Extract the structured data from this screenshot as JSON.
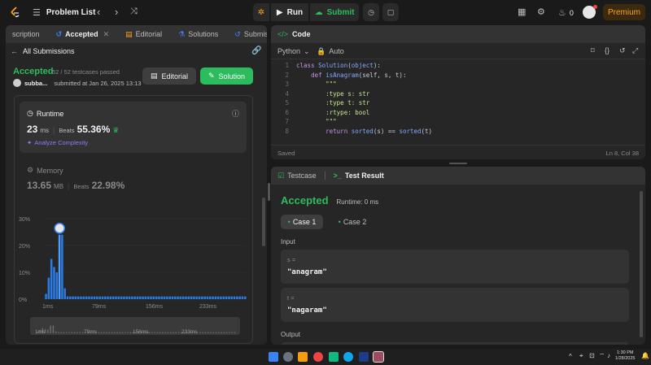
{
  "topbar": {
    "title": "Problem List",
    "run_label": "Run",
    "submit_label": "Submit",
    "streak_count": "0",
    "premium_label": "Premium"
  },
  "left_tabs": {
    "description": "scription",
    "accepted": "Accepted",
    "editorial": "Editorial",
    "solutions": "Solutions",
    "submissions": "Submissions"
  },
  "submission": {
    "back_label": "All Submissions",
    "status": "Accepted",
    "testcases": "52 / 52 testcases passed",
    "user": "subba...",
    "submitted_at": "submitted at Jan 26, 2025 13:13",
    "editorial_btn": "Editorial",
    "solution_btn": "Solution",
    "runtime_label": "Runtime",
    "runtime_value": "23",
    "runtime_unit": "ms",
    "beats_label": "Beats",
    "runtime_beats": "55.36%",
    "analyze_label": "Analyze Complexity",
    "memory_label": "Memory",
    "memory_value": "13.65",
    "memory_unit": "MB",
    "memory_beats": "22.98%"
  },
  "chart_data": {
    "type": "bar",
    "y_ticks": [
      "30%",
      "20%",
      "10%",
      "0%"
    ],
    "x_ticks": [
      "1ms",
      "79ms",
      "156ms",
      "233ms"
    ],
    "ylim": [
      0,
      30
    ],
    "values": [
      2,
      8,
      15,
      12,
      10,
      24,
      24,
      4,
      1,
      1,
      1,
      1,
      1,
      1,
      1,
      1,
      1,
      1,
      1,
      1,
      1,
      1,
      1,
      1,
      1,
      1,
      1,
      1,
      1,
      1,
      1,
      1,
      1,
      1,
      1,
      1,
      1,
      1,
      1,
      1,
      1,
      1,
      1,
      1,
      1,
      1,
      1,
      1,
      1,
      1,
      1,
      1,
      1,
      1,
      1,
      1,
      1,
      1,
      1,
      1,
      1,
      1,
      1,
      1,
      1,
      1,
      1,
      1,
      1,
      1,
      1,
      1,
      1,
      1,
      1
    ],
    "highlight_index": 5,
    "colors": {
      "bar": "#2a7be4",
      "highlight": "#4a9cff"
    }
  },
  "code_panel": {
    "title": "Code",
    "language": "Python",
    "auto_label": "Auto",
    "saved_label": "Saved",
    "cursor_label": "Ln 8, Col 38",
    "lines": [
      {
        "n": "1",
        "t": "class Solution(object):"
      },
      {
        "n": "2",
        "t": "    def isAnagram(self, s, t):"
      },
      {
        "n": "3",
        "t": "        \"\"\""
      },
      {
        "n": "4",
        "t": "        :type s: str"
      },
      {
        "n": "5",
        "t": "        :type t: str"
      },
      {
        "n": "6",
        "t": "        :rtype: bool"
      },
      {
        "n": "7",
        "t": "        \"\"\""
      },
      {
        "n": "8",
        "t": "        return sorted(s) == sorted(t)"
      }
    ]
  },
  "result_panel": {
    "testcase_tab": "Testcase",
    "result_tab": "Test Result",
    "status": "Accepted",
    "runtime": "Runtime: 0 ms",
    "case1": "Case 1",
    "case2": "Case 2",
    "input_label": "Input",
    "s_label": "s =",
    "s_value": "\"anagram\"",
    "t_label": "t =",
    "t_value": "\"nagaram\"",
    "output_label": "Output"
  },
  "taskbar": {
    "time": "1:30 PM",
    "date": "1/28/2025"
  }
}
